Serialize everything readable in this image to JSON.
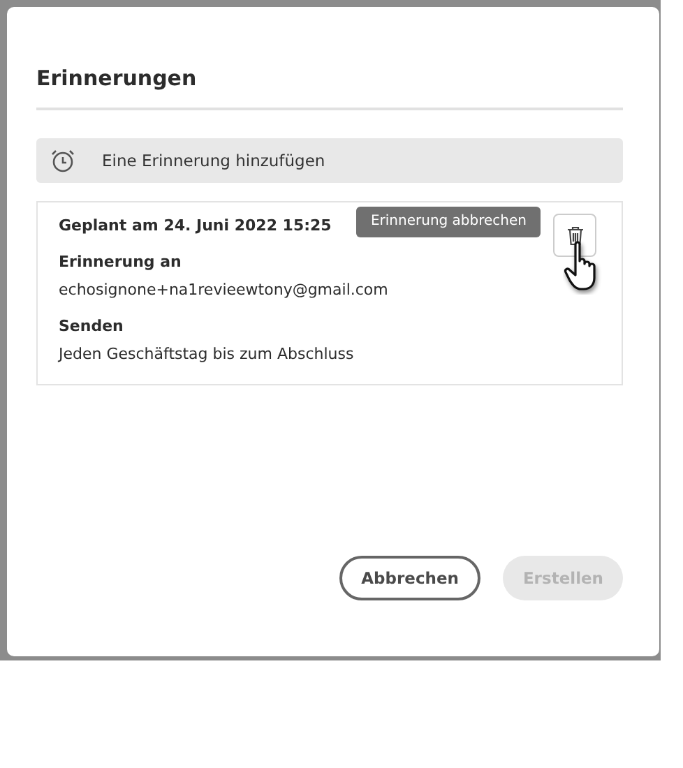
{
  "dialog": {
    "title": "Erinnerungen",
    "add_button": {
      "label": "Eine Erinnerung hinzufügen"
    },
    "reminder": {
      "scheduled": "Geplant am 24. Juni 2022 15:25",
      "recipient_label": "Erinnerung an",
      "recipient": "echosignone+na1revieewtony@gmail.com",
      "send_label": "Senden",
      "send_value": "Jeden Geschäftstag bis zum Abschluss",
      "tooltip": "Erinnerung abbrechen"
    },
    "buttons": [
      {
        "label": "Abbrechen",
        "kind": "secondary",
        "disabled": false
      },
      {
        "label": "Erstellen",
        "kind": "primary",
        "disabled": true
      }
    ]
  }
}
